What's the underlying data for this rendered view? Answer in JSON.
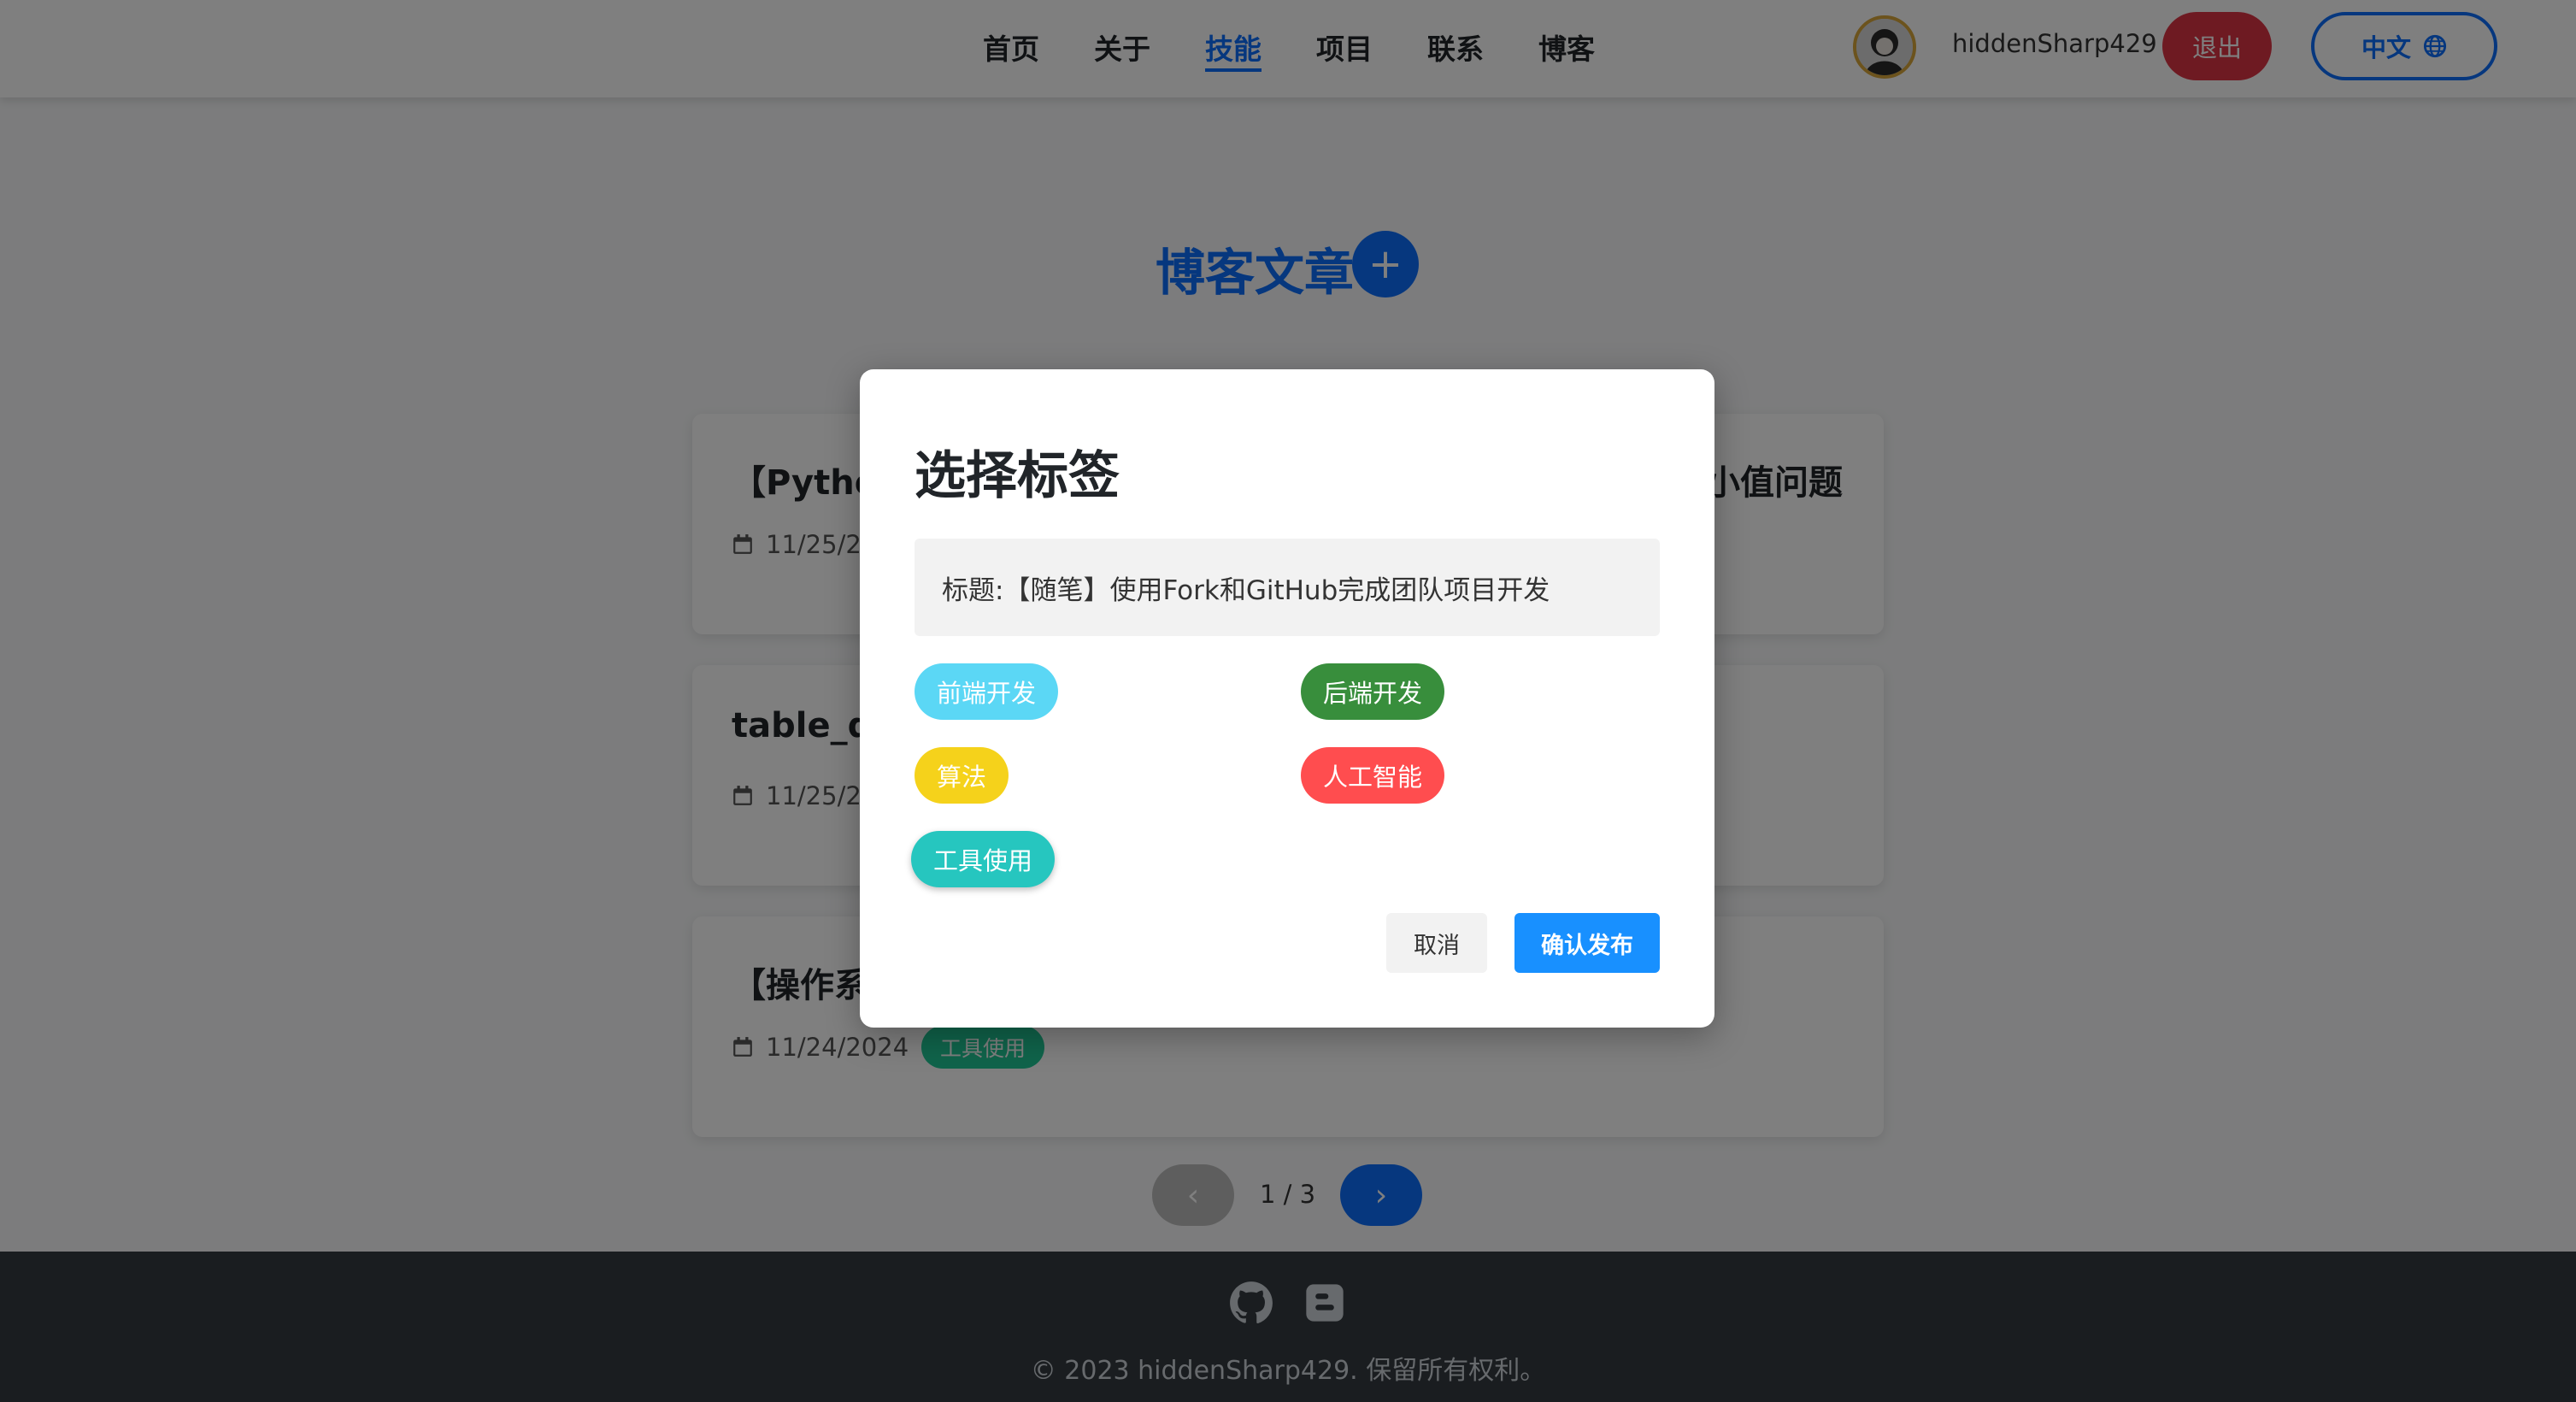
{
  "navbar": {
    "links": [
      "首页",
      "关于",
      "技能",
      "项目",
      "联系",
      "博客"
    ],
    "active_index": 2,
    "username": "hiddenSharp429",
    "logout_label": "退出",
    "language_label": "中文"
  },
  "blog": {
    "title": "博客文章",
    "add_label": "+",
    "cards": [
      {
        "title": "【Pytho",
        "title_right": "小值问题",
        "date": "11/25/20"
      },
      {
        "title": "table_d",
        "date": "11/25/20"
      },
      {
        "title": "【操作系",
        "date": "11/24/2024",
        "tag": "工具使用"
      }
    ]
  },
  "pagination": {
    "prev_icon": "‹",
    "info": "1 / 3",
    "next_icon": "›"
  },
  "footer": {
    "icons": [
      "github-icon",
      "blogger-icon"
    ],
    "copyright": "© 2023 hiddenSharp429. 保留所有权利。"
  },
  "modal": {
    "title": "选择标签",
    "post_title": "标题:【随笔】使用Fork和GitHub完成团队项目开发",
    "tags": [
      {
        "label": "前端开发",
        "color": "#5bd7f5"
      },
      {
        "label": "后端开发",
        "color": "#388e3c"
      },
      {
        "label": "算法",
        "color": "#f5d21b"
      },
      {
        "label": "人工智能",
        "color": "#ff4d4f"
      },
      {
        "label": "工具使用",
        "color": "#26c6bf"
      }
    ],
    "cancel_label": "取消",
    "confirm_label": "确认发布"
  },
  "colors": {
    "primary": "#0d6efd",
    "danger": "#dc3545",
    "confirm": "#1890ff",
    "footer": "#343a40"
  }
}
